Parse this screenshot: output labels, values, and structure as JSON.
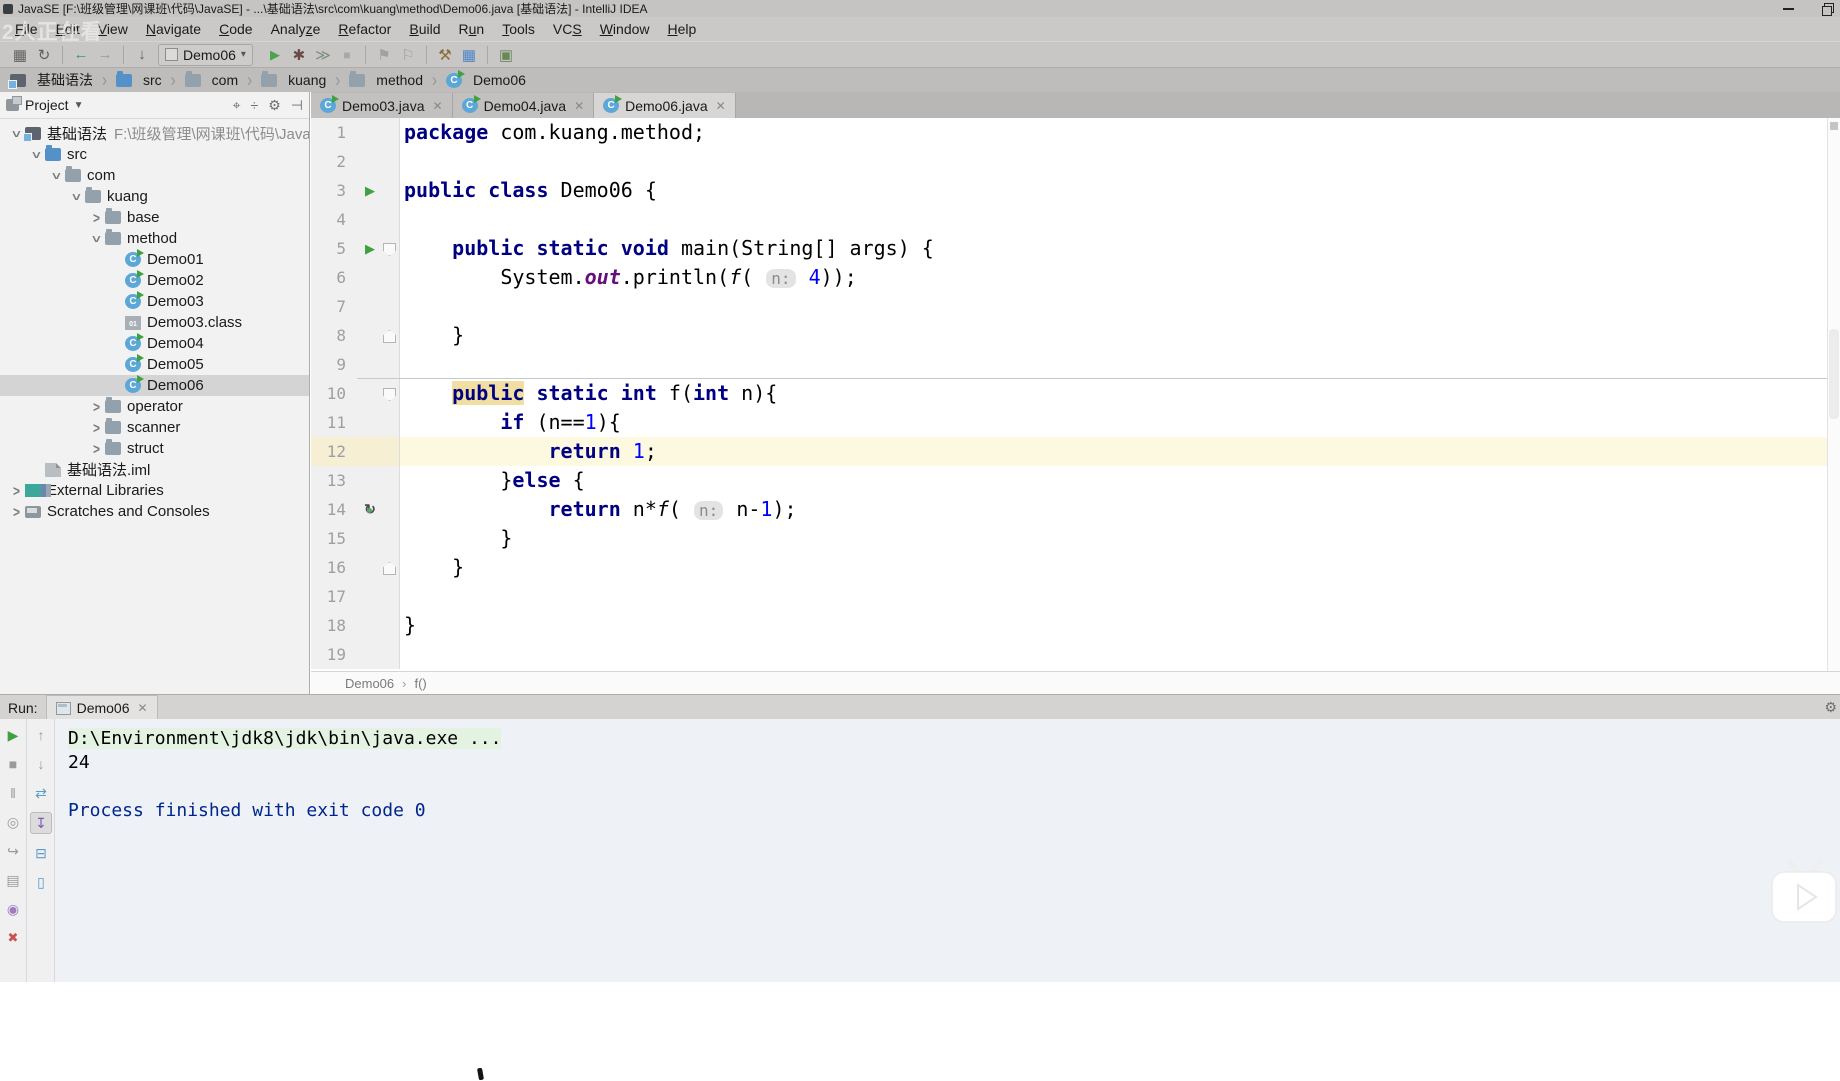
{
  "window": {
    "title": "JavaSE [F:\\班级管理\\网课班\\代码\\JavaSE] - ...\\基础语法\\src\\com\\kuang\\method\\Demo06.java [基础语法] - IntelliJ IDEA",
    "controls": [
      "minimize",
      "restore"
    ]
  },
  "overlay": {
    "viewers_text": "2人正在看"
  },
  "colors": {
    "keyword": "#000080",
    "number": "#0000ff",
    "static_field": "#660e7a",
    "caret_line": "#fdf8e0",
    "usage_highlight": "#f0dfa1",
    "run_green": "#3fa13f",
    "process_text": "#00258c",
    "selection_gray": "#d4d4d4"
  },
  "menu": {
    "items": [
      {
        "label": "File",
        "u": 0
      },
      {
        "label": "Edit",
        "u": 0
      },
      {
        "label": "View",
        "u": 0
      },
      {
        "label": "Navigate",
        "u": 0
      },
      {
        "label": "Code",
        "u": 0
      },
      {
        "label": "Analyze",
        "u": 5
      },
      {
        "label": "Refactor",
        "u": 0
      },
      {
        "label": "Build",
        "u": 0
      },
      {
        "label": "Run",
        "u": 1
      },
      {
        "label": "Tools",
        "u": 0
      },
      {
        "label": "VCS",
        "u": 2
      },
      {
        "label": "Window",
        "u": 0
      },
      {
        "label": "Help",
        "u": 0
      }
    ]
  },
  "toolbar": {
    "left_buttons": [
      "save",
      "synchronize",
      "sep",
      "back",
      "forward",
      "sep",
      "sort-lines"
    ],
    "run_config": {
      "label": "Demo06"
    },
    "right_buttons": [
      "run",
      "debug",
      "coverage",
      "stop",
      "sep",
      "flag1",
      "flag2",
      "sep",
      "settings",
      "project-structure",
      "sep",
      "plugins"
    ]
  },
  "breadcrumbs": {
    "items": [
      {
        "label": "基础语法",
        "icon": "module"
      },
      {
        "label": "src",
        "icon": "folder-src"
      },
      {
        "label": "com",
        "icon": "package"
      },
      {
        "label": "kuang",
        "icon": "package"
      },
      {
        "label": "method",
        "icon": "package"
      },
      {
        "label": "Demo06",
        "icon": "class"
      }
    ]
  },
  "project_panel": {
    "header": {
      "title": "Project",
      "tools": [
        "locate",
        "collapse-all",
        "settings",
        "hide"
      ]
    },
    "tree": [
      {
        "label": "基础语法",
        "suffix": "F:\\班级管理\\网课班\\代码\\JavaSE\\基础语法",
        "lvl": 0,
        "ch": "open",
        "icon": "module"
      },
      {
        "label": "src",
        "lvl": 1,
        "ch": "open",
        "icon": "folder-src"
      },
      {
        "label": "com",
        "lvl": 2,
        "ch": "open",
        "icon": "package"
      },
      {
        "label": "kuang",
        "lvl": 3,
        "ch": "open",
        "icon": "package"
      },
      {
        "label": "base",
        "lvl": 4,
        "ch": "closed",
        "icon": "package"
      },
      {
        "label": "method",
        "lvl": 4,
        "ch": "open",
        "icon": "package"
      },
      {
        "label": "Demo01",
        "lvl": 5,
        "icon": "class"
      },
      {
        "label": "Demo02",
        "lvl": 5,
        "icon": "class"
      },
      {
        "label": "Demo03",
        "lvl": 5,
        "icon": "class"
      },
      {
        "label": "Demo03.class",
        "lvl": 5,
        "icon": "classfile"
      },
      {
        "label": "Demo04",
        "lvl": 5,
        "icon": "class"
      },
      {
        "label": "Demo05",
        "lvl": 5,
        "icon": "class"
      },
      {
        "label": "Demo06",
        "lvl": 5,
        "icon": "class",
        "sel": true
      },
      {
        "label": "operator",
        "lvl": 4,
        "ch": "closed",
        "icon": "package"
      },
      {
        "label": "scanner",
        "lvl": 4,
        "ch": "closed",
        "icon": "package"
      },
      {
        "label": "struct",
        "lvl": 4,
        "ch": "closed",
        "icon": "package"
      },
      {
        "label": "基础语法.iml",
        "lvl": 1,
        "icon": "iml"
      },
      {
        "label": "External Libraries",
        "lvl": 0,
        "ch": "closed",
        "icon": "lib"
      },
      {
        "label": "Scratches and Consoles",
        "lvl": 0,
        "ch": "closed",
        "icon": "scratch"
      }
    ]
  },
  "editor": {
    "tabs": [
      {
        "label": "Demo03.java",
        "active": false
      },
      {
        "label": "Demo04.java",
        "active": false
      },
      {
        "label": "Demo06.java",
        "active": true
      }
    ],
    "lines": [
      {
        "n": 1,
        "tokens": [
          [
            "kw",
            "package"
          ],
          [
            "pl",
            " com.kuang.method;"
          ]
        ]
      },
      {
        "n": 2,
        "tokens": []
      },
      {
        "n": 3,
        "g": "run",
        "tokens": [
          [
            "kw",
            "public"
          ],
          [
            "pl",
            " "
          ],
          [
            "kw",
            "class"
          ],
          [
            "pl",
            " Demo06 {"
          ]
        ]
      },
      {
        "n": 4,
        "tokens": []
      },
      {
        "n": 5,
        "g": "run fold",
        "tokens": [
          [
            "pl",
            "    "
          ],
          [
            "kw",
            "public"
          ],
          [
            "pl",
            " "
          ],
          [
            "kw",
            "static"
          ],
          [
            "pl",
            " "
          ],
          [
            "kw",
            "void"
          ],
          [
            "pl",
            " main(String[] args) {"
          ]
        ]
      },
      {
        "n": 6,
        "tokens": [
          [
            "pl",
            "        System."
          ],
          [
            "out",
            "out"
          ],
          [
            "pl",
            ".println("
          ],
          [
            "meth",
            "f"
          ],
          [
            "pl",
            "( "
          ],
          [
            "hint",
            "n:"
          ],
          [
            "pl",
            " "
          ],
          [
            "num",
            "4"
          ],
          [
            "pl",
            "));"
          ]
        ]
      },
      {
        "n": 7,
        "tokens": []
      },
      {
        "n": 8,
        "g": "foldend",
        "tokens": [
          [
            "pl",
            "    }"
          ]
        ]
      },
      {
        "n": 9,
        "tokens": []
      },
      {
        "n": 10,
        "g": "fold",
        "sep": true,
        "tokens": [
          [
            "pl",
            "    "
          ],
          [
            "kwhl",
            "public"
          ],
          [
            "pl",
            " "
          ],
          [
            "kw",
            "static"
          ],
          [
            "pl",
            " "
          ],
          [
            "kw",
            "int"
          ],
          [
            "pl",
            " f("
          ],
          [
            "kw",
            "int"
          ],
          [
            "pl",
            " n){"
          ]
        ]
      },
      {
        "n": 11,
        "tokens": [
          [
            "pl",
            "        "
          ],
          [
            "kw",
            "if"
          ],
          [
            "pl",
            " (n=="
          ],
          [
            "num",
            "1"
          ],
          [
            "pl",
            "){"
          ]
        ]
      },
      {
        "n": 12,
        "cur": true,
        "tokens": [
          [
            "pl",
            "            "
          ],
          [
            "kw",
            "return"
          ],
          [
            "pl",
            " "
          ],
          [
            "num",
            "1"
          ],
          [
            "pl",
            ";"
          ]
        ]
      },
      {
        "n": 13,
        "tokens": [
          [
            "pl",
            "        }"
          ],
          [
            "kw",
            "else"
          ],
          [
            "pl",
            " {"
          ]
        ]
      },
      {
        "n": 14,
        "g": "rec",
        "tokens": [
          [
            "pl",
            "            "
          ],
          [
            "kw",
            "return"
          ],
          [
            "pl",
            " n*"
          ],
          [
            "meth",
            "f"
          ],
          [
            "pl",
            "( "
          ],
          [
            "hint",
            "n:"
          ],
          [
            "pl",
            " n-"
          ],
          [
            "num",
            "1"
          ],
          [
            "pl",
            ");"
          ]
        ]
      },
      {
        "n": 15,
        "tokens": [
          [
            "pl",
            "        }"
          ]
        ]
      },
      {
        "n": 16,
        "g": "foldend",
        "tokens": [
          [
            "pl",
            "    }"
          ]
        ]
      },
      {
        "n": 17,
        "tokens": []
      },
      {
        "n": 18,
        "tokens": [
          [
            "pl",
            "}"
          ]
        ]
      },
      {
        "n": 19,
        "tokens": []
      }
    ],
    "breadcrumb_bottom": [
      "Demo06",
      "f()"
    ]
  },
  "run_panel": {
    "label": "Run:",
    "tab": {
      "label": "Demo06"
    },
    "toolbar_left": [
      "rerun",
      "stop",
      "pause",
      "dump",
      "attach",
      "console-settings",
      "pin",
      "close"
    ],
    "toolbar_inner": [
      "up",
      "down",
      "restore",
      "scrollend",
      "print",
      "clear"
    ],
    "console_lines": [
      {
        "text": "D:\\Environment\\jdk8\\jdk\\bin\\java.exe ...",
        "style": "cmd"
      },
      {
        "text": "24",
        "style": "plain"
      },
      {
        "text": "",
        "style": "plain"
      },
      {
        "text": "Process finished with exit code 0",
        "style": "sys"
      }
    ]
  }
}
